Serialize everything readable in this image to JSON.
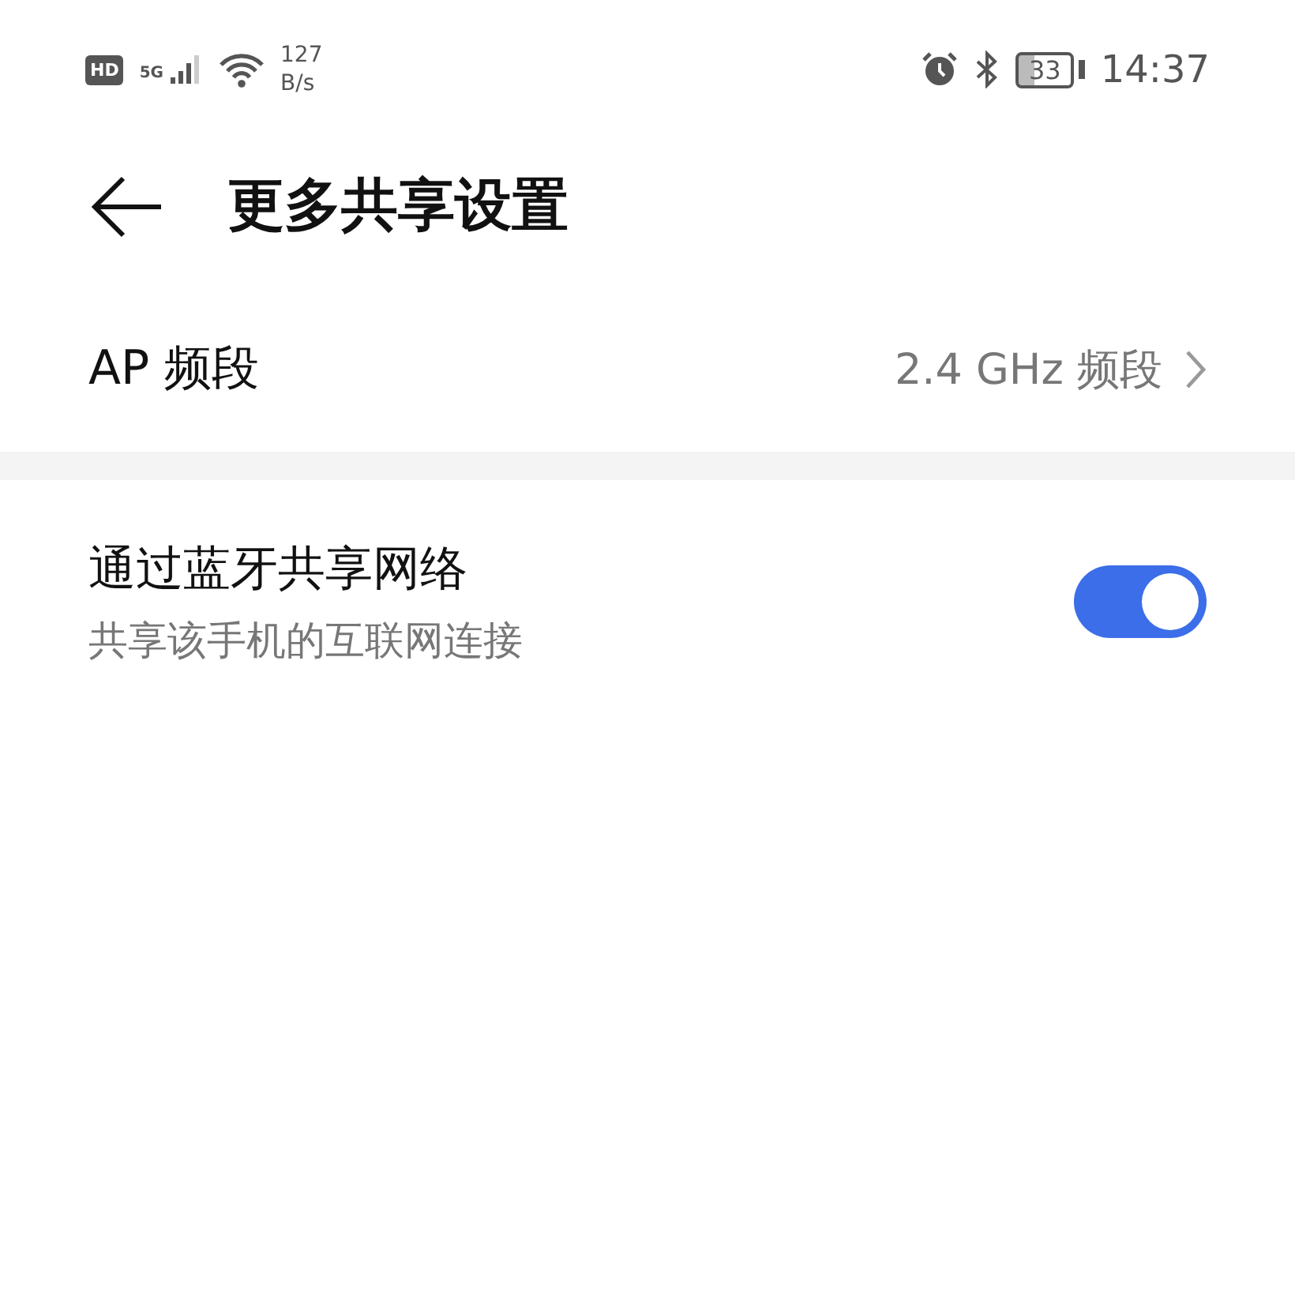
{
  "status_bar": {
    "hd": "HD",
    "network": "5G",
    "speed": [
      "127",
      "B/s"
    ],
    "battery": "33",
    "time": "14:37"
  },
  "header": {
    "title": "更多共享设置"
  },
  "rows": [
    {
      "kind": "value",
      "label": "AP 频段",
      "value": "2.4 GHz 频段"
    },
    {
      "kind": "toggle",
      "label": "通过蓝牙共享网络",
      "subtitle": "共享该手机的互联网连接",
      "on": true
    }
  ]
}
